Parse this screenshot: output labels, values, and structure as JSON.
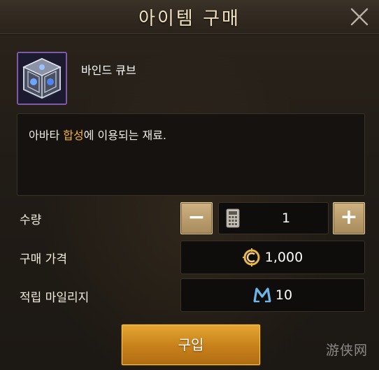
{
  "dialog": {
    "title": "아이템 구매",
    "close_icon": "close-icon"
  },
  "item": {
    "name": "바인드 큐브",
    "icon": "bind-cube-icon",
    "icon_border_color": "#7e5aa8"
  },
  "description": {
    "before": "아바타 ",
    "highlight": "합성",
    "after": "에 이용되는 재료.",
    "highlight_color": "#f2b534"
  },
  "quantity": {
    "label": "수량",
    "minus_label": "−",
    "plus_label": "+",
    "value": "1",
    "calculator_icon": "calculator-icon"
  },
  "price": {
    "label": "구매 가격",
    "currency_icon": "gold-coin-icon",
    "value": "1,000"
  },
  "mileage": {
    "label": "적립 마일리지",
    "currency_icon": "mileage-m-icon",
    "value": "10"
  },
  "buy_button": {
    "label": "구입",
    "color": "#d8911f"
  },
  "watermark": "游侠网"
}
